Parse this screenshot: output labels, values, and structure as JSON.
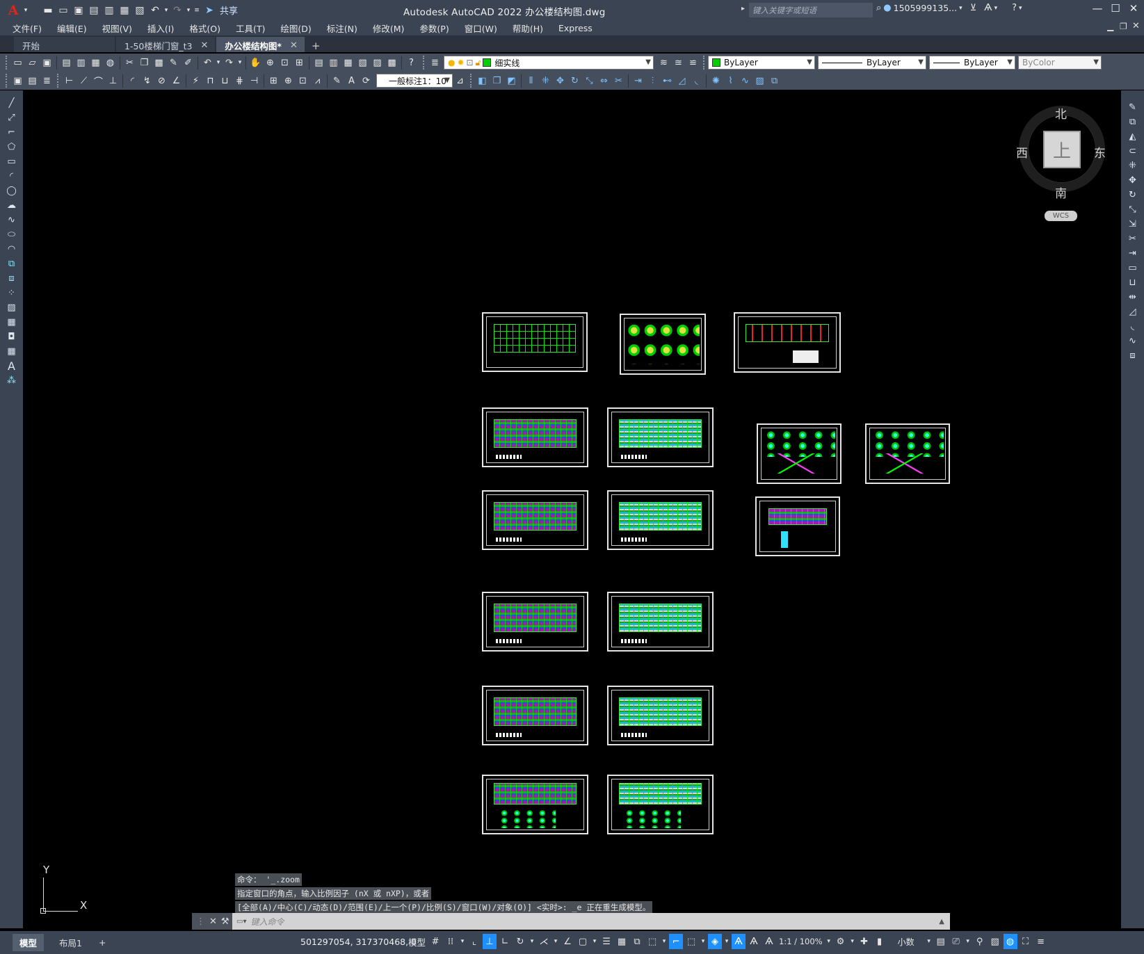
{
  "title": "Autodesk AutoCAD 2022    办公楼结构图.dwg",
  "share_label": "共享",
  "search_placeholder": "键入关键字或短语",
  "user": "1505999135...",
  "menu": [
    "文件(F)",
    "编辑(E)",
    "视图(V)",
    "插入(I)",
    "格式(O)",
    "工具(T)",
    "绘图(D)",
    "标注(N)",
    "修改(M)",
    "参数(P)",
    "窗口(W)",
    "帮助(H)",
    "Express"
  ],
  "tabs": [
    {
      "label": "开始",
      "closable": false,
      "active": false
    },
    {
      "label": "1-50楼梯门窗_t3",
      "closable": true,
      "active": false
    },
    {
      "label": "办公楼结构图*",
      "closable": true,
      "active": true
    }
  ],
  "layer_combo": "细实线",
  "color_combo": "ByLayer",
  "linetype_combo": "ByLayer",
  "lineweight_combo": "ByLayer",
  "plotstyle_combo": "ByColor",
  "dimstyle_combo": "一般标注1：10",
  "viewcube": {
    "north": "北",
    "south": "南",
    "east": "东",
    "west": "西",
    "top": "上",
    "wcs": "WCS"
  },
  "ucs": {
    "x": "X",
    "y": "Y"
  },
  "command_history": [
    "命令： '_.zoom",
    "指定窗口的角点，输入比例因子 (nX 或 nXP)，或者",
    "[全部(A)/中心(C)/动态(D)/范围(E)/上一个(P)/比例(S)/窗口(W)/对象(O)] <实时>: _e 正在重生成模型。"
  ],
  "command_placeholder": "键入命令",
  "layout_tabs": [
    "模型",
    "布局1"
  ],
  "coordinates": "501297054, 317370468, 0",
  "status": {
    "model": "模型",
    "scale": "1:1 / 100%",
    "units": "小数"
  },
  "colors": {
    "accent": "#1e90ff",
    "bg": "#000000",
    "chrome": "#3b4453",
    "layer_green": "#00d000"
  }
}
